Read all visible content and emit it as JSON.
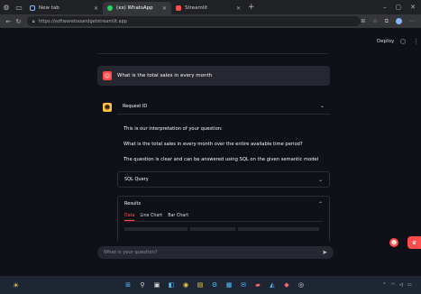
{
  "browser": {
    "tabs": [
      {
        "label": "New tab",
        "fav_color": "#8ab4f8"
      },
      {
        "label": "(xx) WhatsApp",
        "fav_color": "#25d366"
      },
      {
        "label": "Streamlit",
        "fav_color": "#ff4b4b"
      }
    ],
    "url": "https://softwaretooandgetstreamlit.app"
  },
  "header": {
    "deploy_label": "Deploy"
  },
  "chat": {
    "user_message": "What is the total sales in every month",
    "assistant_expander_label": "Request ID",
    "interpretation_intro": "This is our interpretation of your question:",
    "interpretation": "What is the total sales in every month over the entire available time period?",
    "answerable_note": "The question is clear and can be answered using SQL on the given semantic model",
    "sql_expander_label": "SQL Query",
    "results_label": "Results",
    "results_tabs": [
      "Data",
      "Line Chart",
      "Bar Chart"
    ],
    "input_placeholder": "What is your question?"
  },
  "icons": {
    "user_avatar": "person-icon",
    "assistant_avatar": "robot-icon",
    "send": "send-icon"
  },
  "colors": {
    "accent": "#ff4b4b",
    "background": "#0e1117",
    "surface": "#262730"
  }
}
